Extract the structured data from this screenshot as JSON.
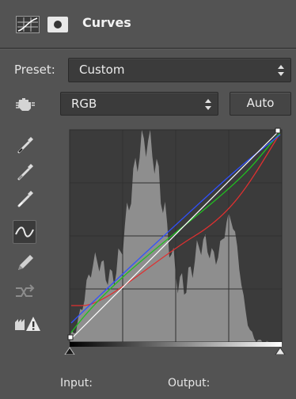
{
  "panel": {
    "title": "Curves",
    "header_icons": [
      "curves-adjustment-icon",
      "mask-icon"
    ]
  },
  "preset": {
    "label": "Preset:",
    "value": "Custom"
  },
  "channel": {
    "value": "RGB"
  },
  "auto_button": {
    "label": "Auto"
  },
  "tools": [
    "on-image-adjust-icon",
    "black-eyedropper-icon",
    "gray-eyedropper-icon",
    "white-eyedropper-icon",
    "curve-points-icon",
    "pencil-icon",
    "smooth-icon",
    "clipping-warning-icon"
  ],
  "curve_colors": {
    "composite": "#ffffff",
    "red": "#e03030",
    "green": "#20c020",
    "blue": "#3050ff"
  },
  "readout": {
    "input_label": "Input:",
    "output_label": "Output:"
  }
}
